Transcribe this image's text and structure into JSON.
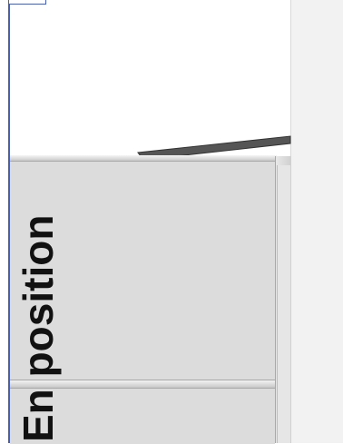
{
  "label": {
    "text": "En position"
  },
  "colors": {
    "border_accent": "#4a5fb0",
    "panel": "#f2f2f2",
    "cabinet": "#dcdcdc",
    "lid": "#555555",
    "text": "#111111"
  }
}
